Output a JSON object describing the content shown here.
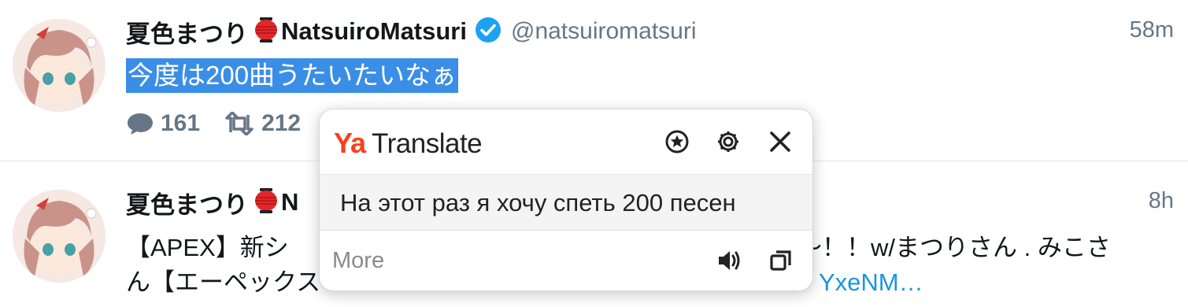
{
  "tweets": [
    {
      "display_name": "夏色まつり",
      "display_name_suffix": "NatsuiroMatsuri",
      "handle": "@natsuiromatsuri",
      "time": "58m",
      "text": "今度は200曲うたいたいなぁ",
      "reply_count": "161",
      "retweet_count": "212"
    },
    {
      "display_name": "夏色まつり",
      "display_name_suffix": "N",
      "time": "8h",
      "text_line1_left": "【APEX】新シ",
      "text_line1_right": "〜！！w/まつりさん . みこさ",
      "text_line2_left": "ん【エーペックス",
      "text_line2_link": "YxeNM…"
    }
  ],
  "translate_popup": {
    "brand_ya": "Ya",
    "brand_name": "Translate",
    "translation": "На этот раз я хочу спеть 200 песен",
    "more_label": "More",
    "icons": [
      "favorite-icon",
      "settings-icon",
      "close-icon",
      "speaker-icon",
      "copy-icon"
    ]
  },
  "colors": {
    "selection": "#3a8ee6",
    "verified": "#1da1f2",
    "yandex_red": "#fc3f1d",
    "muted": "#657786",
    "link": "#1b95e0"
  }
}
